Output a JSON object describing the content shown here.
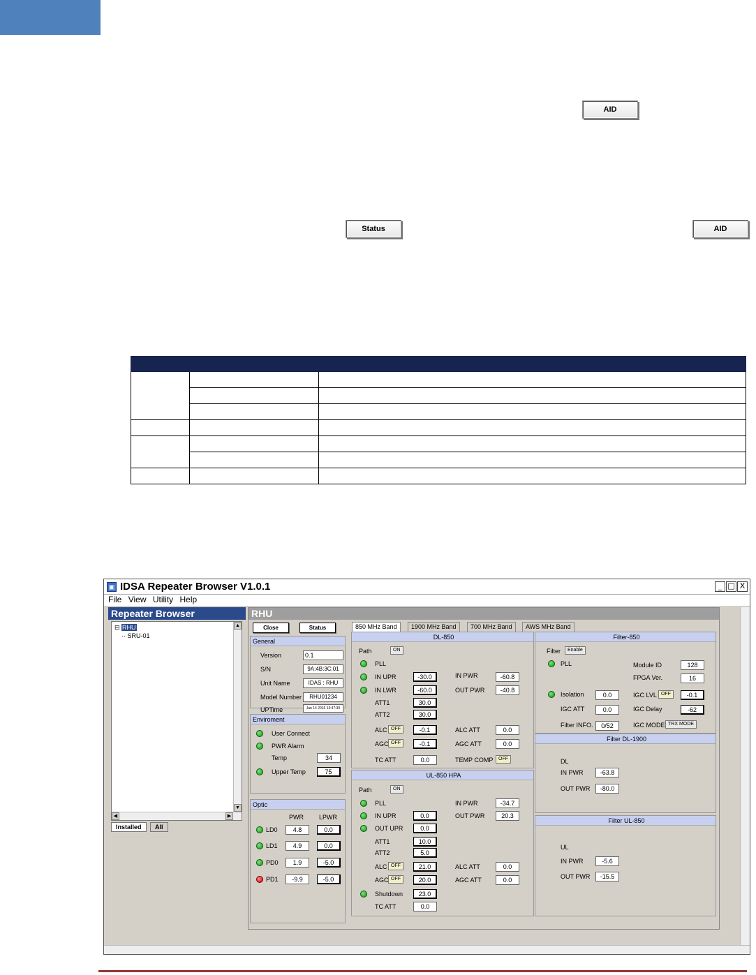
{
  "doc": {
    "aid_btn_1": "AID",
    "status_btn": "Status",
    "aid_btn_2": "AID"
  },
  "window": {
    "title": "IDSA Repeater Browser V1.0.1",
    "menu": [
      "File",
      "View",
      "Utility",
      "Help"
    ],
    "controls": [
      "_",
      "□",
      "X"
    ]
  },
  "left": {
    "title": "Repeater Browser",
    "tree": [
      "RHU",
      "SRU-01"
    ],
    "tabs": [
      "Installed",
      "All"
    ]
  },
  "main": {
    "title": "RHU",
    "close_btn": "Close",
    "status_btn": "Status",
    "general": {
      "head": "General",
      "rows": [
        {
          "label": "Version",
          "value": "0.1"
        },
        {
          "label": "S/N",
          "value": "9A:4B:3C:01"
        },
        {
          "label": "Unit Name",
          "value": "IDAS : RHU"
        },
        {
          "label": "Model Number",
          "value": "RHU01234"
        },
        {
          "label": "UPTime",
          "value": "Jan 14 2016 13:47:30"
        }
      ]
    },
    "environment": {
      "head": "Enviroment",
      "user_connect": "User Connect",
      "pwr_alarm": "PWR Alarm",
      "temp_label": "Temp",
      "temp_value": "34",
      "upper_temp_label": "Upper Temp",
      "upper_temp_value": "75"
    },
    "optic": {
      "head": "Optic",
      "col_pwr": "PWR",
      "col_lpwr": "LPWR",
      "rows": [
        {
          "label": "LD0",
          "pwr": "4.8",
          "lpwr": "0.0",
          "led": "green"
        },
        {
          "label": "LD1",
          "pwr": "4.9",
          "lpwr": "0.0",
          "led": "green"
        },
        {
          "label": "PD0",
          "pwr": "1.9",
          "lpwr": "-5.0",
          "led": "green"
        },
        {
          "label": "PD1",
          "pwr": "-9.9",
          "lpwr": "-5.0",
          "led": "red"
        }
      ]
    },
    "bands": [
      "850 MHz Band",
      "1900 MHz Band",
      "700 MHz Band",
      "AWS MHz Band"
    ],
    "dl": {
      "head": "DL-850",
      "path": "Path",
      "path_state": "ON",
      "pll": "PLL",
      "in_upr": "IN UPR",
      "in_upr_val": "-30.0",
      "in_lwr": "IN LWR",
      "in_lwr_val": "-60.0",
      "att1": "ATT1",
      "att1_val": "30.0",
      "att2": "ATT2",
      "att2_val": "30.0",
      "alc": "ALC",
      "alc_state": "OFF",
      "alc_val": "-0.1",
      "agc": "AGC",
      "agc_state": "OFF",
      "agc_val": "-0.1",
      "tc_att": "TC ATT",
      "tc_att_val": "0.0",
      "in_pwr": "IN PWR",
      "in_pwr_val": "-60.8",
      "out_pwr": "OUT PWR",
      "out_pwr_val": "-40.8",
      "alc_att": "ALC ATT",
      "alc_att_val": "0.0",
      "agc_att": "AGC ATT",
      "agc_att_val": "0.0",
      "temp_comp": "TEMP COMP",
      "temp_comp_state": "OFF"
    },
    "ul": {
      "head": "UL-850 HPA",
      "path": "Path",
      "path_state": "ON",
      "pll": "PLL",
      "in_upr": "IN UPR",
      "in_upr_val": "0.0",
      "out_upr": "OUT UPR",
      "out_upr_val": "0.0",
      "att1": "ATT1",
      "att1_val": "10.0",
      "att2": "ATT2",
      "att2_val": "5.0",
      "alc": "ALC",
      "alc_state": "OFF",
      "alc_val": "21.0",
      "agc": "AGC",
      "agc_state": "OFF",
      "agc_val": "20.0",
      "shutdown": "Shutdown",
      "shutdown_val": "23.0",
      "tc_att": "TC ATT",
      "tc_att_val": "0.0",
      "in_pwr": "IN PWR",
      "in_pwr_val": "-34.7",
      "out_pwr": "OUT PWR",
      "out_pwr_val": "20.3",
      "alc_att": "ALC ATT",
      "alc_att_val": "0.0",
      "agc_att": "AGC ATT",
      "agc_att_val": "0.0"
    },
    "filter": {
      "head": "Filter-850",
      "filter_label": "Filter",
      "filter_state": "Enable",
      "pll": "PLL",
      "module_id": "Module ID",
      "module_id_val": "128",
      "fpga_ver": "FPGA Ver.",
      "fpga_ver_val": "16",
      "isolation": "Isolation",
      "isolation_val": "0.0",
      "igc_lvl": "IGC LVL",
      "igc_lvl_state": "OFF",
      "igc_lvl_val": "-0.1",
      "igc_att": "IGC ATT",
      "igc_att_val": "0.0",
      "igc_delay": "IGC Delay",
      "igc_delay_val": "-62",
      "filter_info": "Filter INFO.",
      "filter_info_val": "0/52",
      "igc_mode": "IGC MODE",
      "igc_mode_state": "TRX MODE"
    },
    "filter_dl": {
      "head": "Filter DL-1900",
      "sub": "DL",
      "in_pwr": "IN PWR",
      "in_pwr_val": "-63.8",
      "out_pwr": "OUT PWR",
      "out_pwr_val": "-80.0"
    },
    "filter_ul": {
      "head": "Filter UL-850",
      "sub": "UL",
      "in_pwr": "IN PWR",
      "in_pwr_val": "-5.6",
      "out_pwr": "OUT PWR",
      "out_pwr_val": "-15.5"
    }
  }
}
